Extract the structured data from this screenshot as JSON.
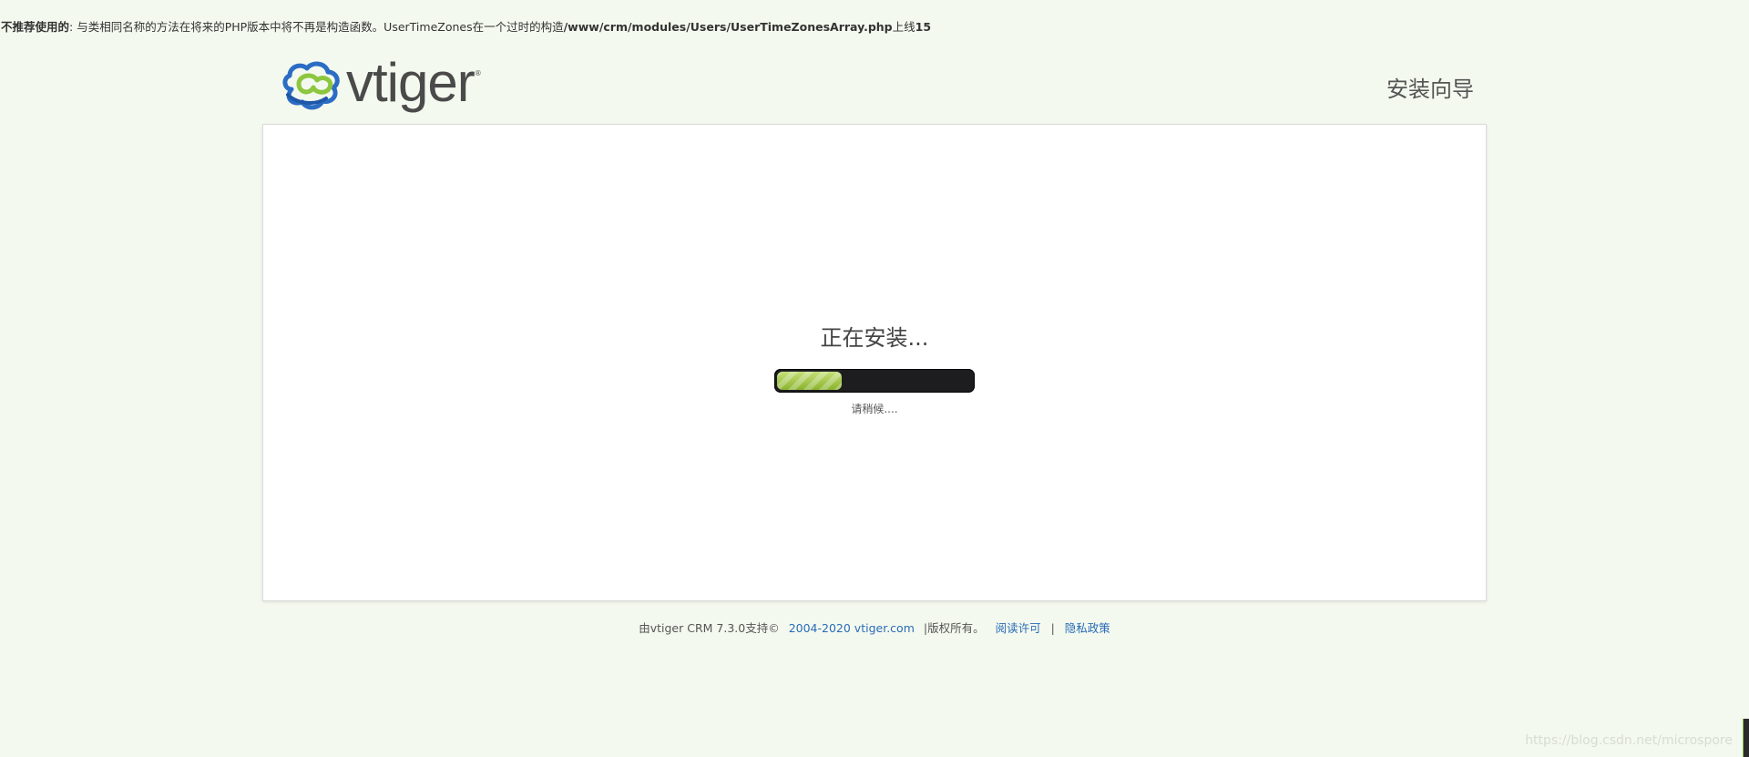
{
  "notice": {
    "label": "不推荐使用的",
    "message": ": 与类相同名称的方法在将来的PHP版本中将不再是构造函数。UserTimeZones在一个过时的构造",
    "path": "/www/crm/modules/Users/UserTimeZonesArray.php",
    "line_prefix": "上线",
    "line_number": "15"
  },
  "header": {
    "logo_text": "vtiger",
    "logo_reg": "®",
    "wizard_title": "安装向导"
  },
  "main": {
    "status_title": "正在安装...",
    "progress_percent": 33,
    "wait_text": "请稍候...."
  },
  "footer": {
    "powered_by": "由vtiger CRM 7.3.0支持©",
    "copyright_link": "2004-2020 vtiger.com",
    "rights_text": "|版权所有。",
    "license_link": "阅读许可",
    "separator": "|",
    "privacy_link": "隐私政策"
  },
  "watermark": "https://blog.csdn.net/microspore",
  "colors": {
    "background": "#f4f9ef",
    "link": "#2a6cb8",
    "progress_fill": "#9cc43e",
    "progress_track": "#1d1d1f",
    "logo_blue": "#2b6cc4",
    "logo_green": "#8dc63f"
  }
}
